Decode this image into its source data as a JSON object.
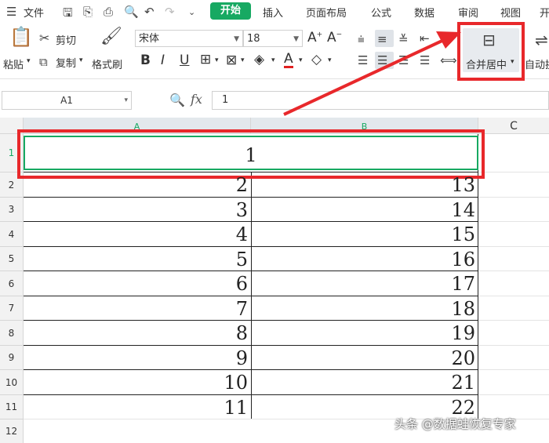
{
  "menubar": {
    "file_label": "文件",
    "home_tab": "开始",
    "tabs": [
      "插入",
      "页面布局",
      "公式",
      "数据",
      "审阅",
      "视图",
      "开"
    ]
  },
  "ribbon": {
    "paste_label": "粘贴",
    "cut_label": "剪切",
    "copy_label": "复制",
    "format_painter_label": "格式刷",
    "font_name": "宋体",
    "font_size": "18",
    "merge_center_label": "合并居中",
    "auto_wrap_label": "自动换"
  },
  "formula_bar": {
    "name_box": "A1",
    "fx_label": "fx",
    "value": "1"
  },
  "grid": {
    "columns": [
      "A",
      "B",
      "C"
    ],
    "rows": [
      "1",
      "2",
      "3",
      "4",
      "5",
      "6",
      "7",
      "8",
      "9",
      "10",
      "11",
      "12"
    ],
    "merged_a1": "1",
    "col_a": [
      "2",
      "3",
      "4",
      "5",
      "6",
      "7",
      "8",
      "9",
      "10",
      "11"
    ],
    "col_b": [
      "13",
      "14",
      "15",
      "16",
      "17",
      "18",
      "19",
      "20",
      "21",
      "22"
    ]
  },
  "watermark": "头条 @数据蛙恢复专家",
  "colors": {
    "accent_green": "#17a962",
    "highlight_red": "#e8282b"
  }
}
